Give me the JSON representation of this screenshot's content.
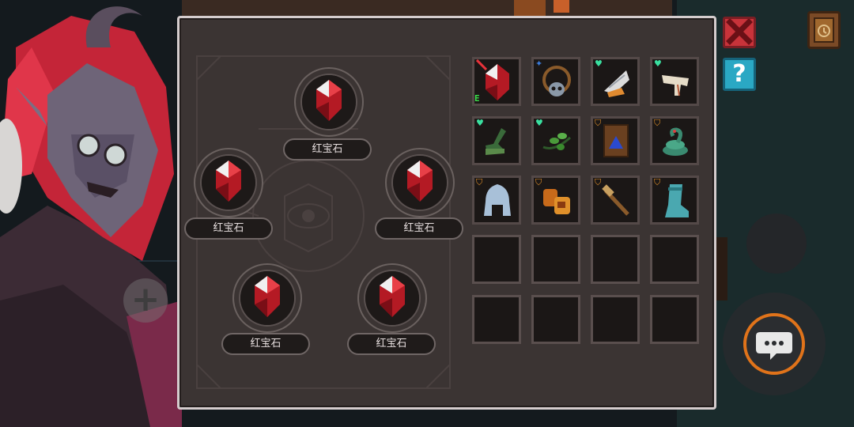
{
  "scene": {
    "character": "vampire-portrait"
  },
  "hud": {
    "close_icon": "close-icon",
    "help_label": "?",
    "journal_icon": "journal-icon",
    "add_label": "+",
    "chat_icon": "chat-bubble-icon"
  },
  "sockets": [
    {
      "label": "红宝石",
      "icon": "ruby-gem-icon"
    },
    {
      "label": "红宝石",
      "icon": "ruby-gem-icon"
    },
    {
      "label": "红宝石",
      "icon": "ruby-gem-icon"
    },
    {
      "label": "红宝石",
      "icon": "ruby-gem-icon"
    },
    {
      "label": "红宝石",
      "icon": "ruby-gem-icon"
    }
  ],
  "inventory": {
    "rows": [
      [
        {
          "icon": "ruby-crystal-icon",
          "badge": "red-sword",
          "equipped": "E"
        },
        {
          "icon": "skull-amulet-icon",
          "badge": "blue-star"
        },
        {
          "icon": "feather-wing-icon",
          "badge": "green-heart"
        },
        {
          "icon": "bone-icon",
          "badge": "green-heart"
        }
      ],
      [
        {
          "icon": "green-boot-icon",
          "badge": "green-heart"
        },
        {
          "icon": "herb-sprig-icon",
          "badge": "green-heart"
        },
        {
          "icon": "rune-tablet-icon",
          "badge": "orange-shield"
        },
        {
          "icon": "coiled-snake-icon",
          "badge": "orange-shield"
        }
      ],
      [
        {
          "icon": "steel-helmet-icon",
          "badge": "orange-shield"
        },
        {
          "icon": "amber-gauntlet-icon",
          "badge": "orange-shield"
        },
        {
          "icon": "wooden-hammer-icon",
          "badge": "orange-shield"
        },
        {
          "icon": "teal-boot-icon",
          "badge": "orange-shield"
        }
      ],
      [
        {},
        {},
        {},
        {}
      ],
      [
        {},
        {},
        {},
        {}
      ]
    ]
  },
  "colors": {
    "panel_bg": "#3b3433",
    "panel_border": "#d4cccd",
    "ruby": "#c8202a",
    "close_red": "#c8333a",
    "help_teal": "#2aa8c4",
    "chat_ring": "#e0731a"
  }
}
